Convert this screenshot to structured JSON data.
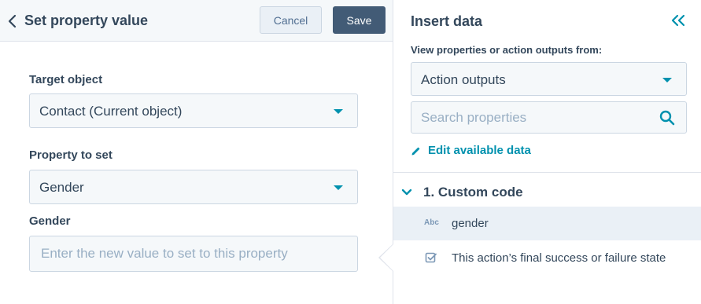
{
  "header": {
    "title": "Set property value",
    "cancel_label": "Cancel",
    "save_label": "Save"
  },
  "form": {
    "target_label": "Target object",
    "target_value": "Contact (Current object)",
    "property_label": "Property to set",
    "property_value": "Gender",
    "value_label": "Gender",
    "value_placeholder": "Enter the new value to set to this property",
    "value_current": ""
  },
  "insert_panel": {
    "title": "Insert data",
    "source_label": "View properties or action outputs from:",
    "source_value": "Action outputs",
    "search_placeholder": "Search properties",
    "edit_link": "Edit available data",
    "section_title": "1. Custom code",
    "items": [
      {
        "type_badge": "Abc",
        "label": "gender"
      },
      {
        "icon": "checkbox-icon",
        "label": "This action’s final success or failure state"
      }
    ]
  },
  "colors": {
    "accent": "#0091ae",
    "primary_button": "#425b76",
    "text": "#33475b",
    "field_bg": "#f5f8fa",
    "border": "#cbd6e2"
  }
}
